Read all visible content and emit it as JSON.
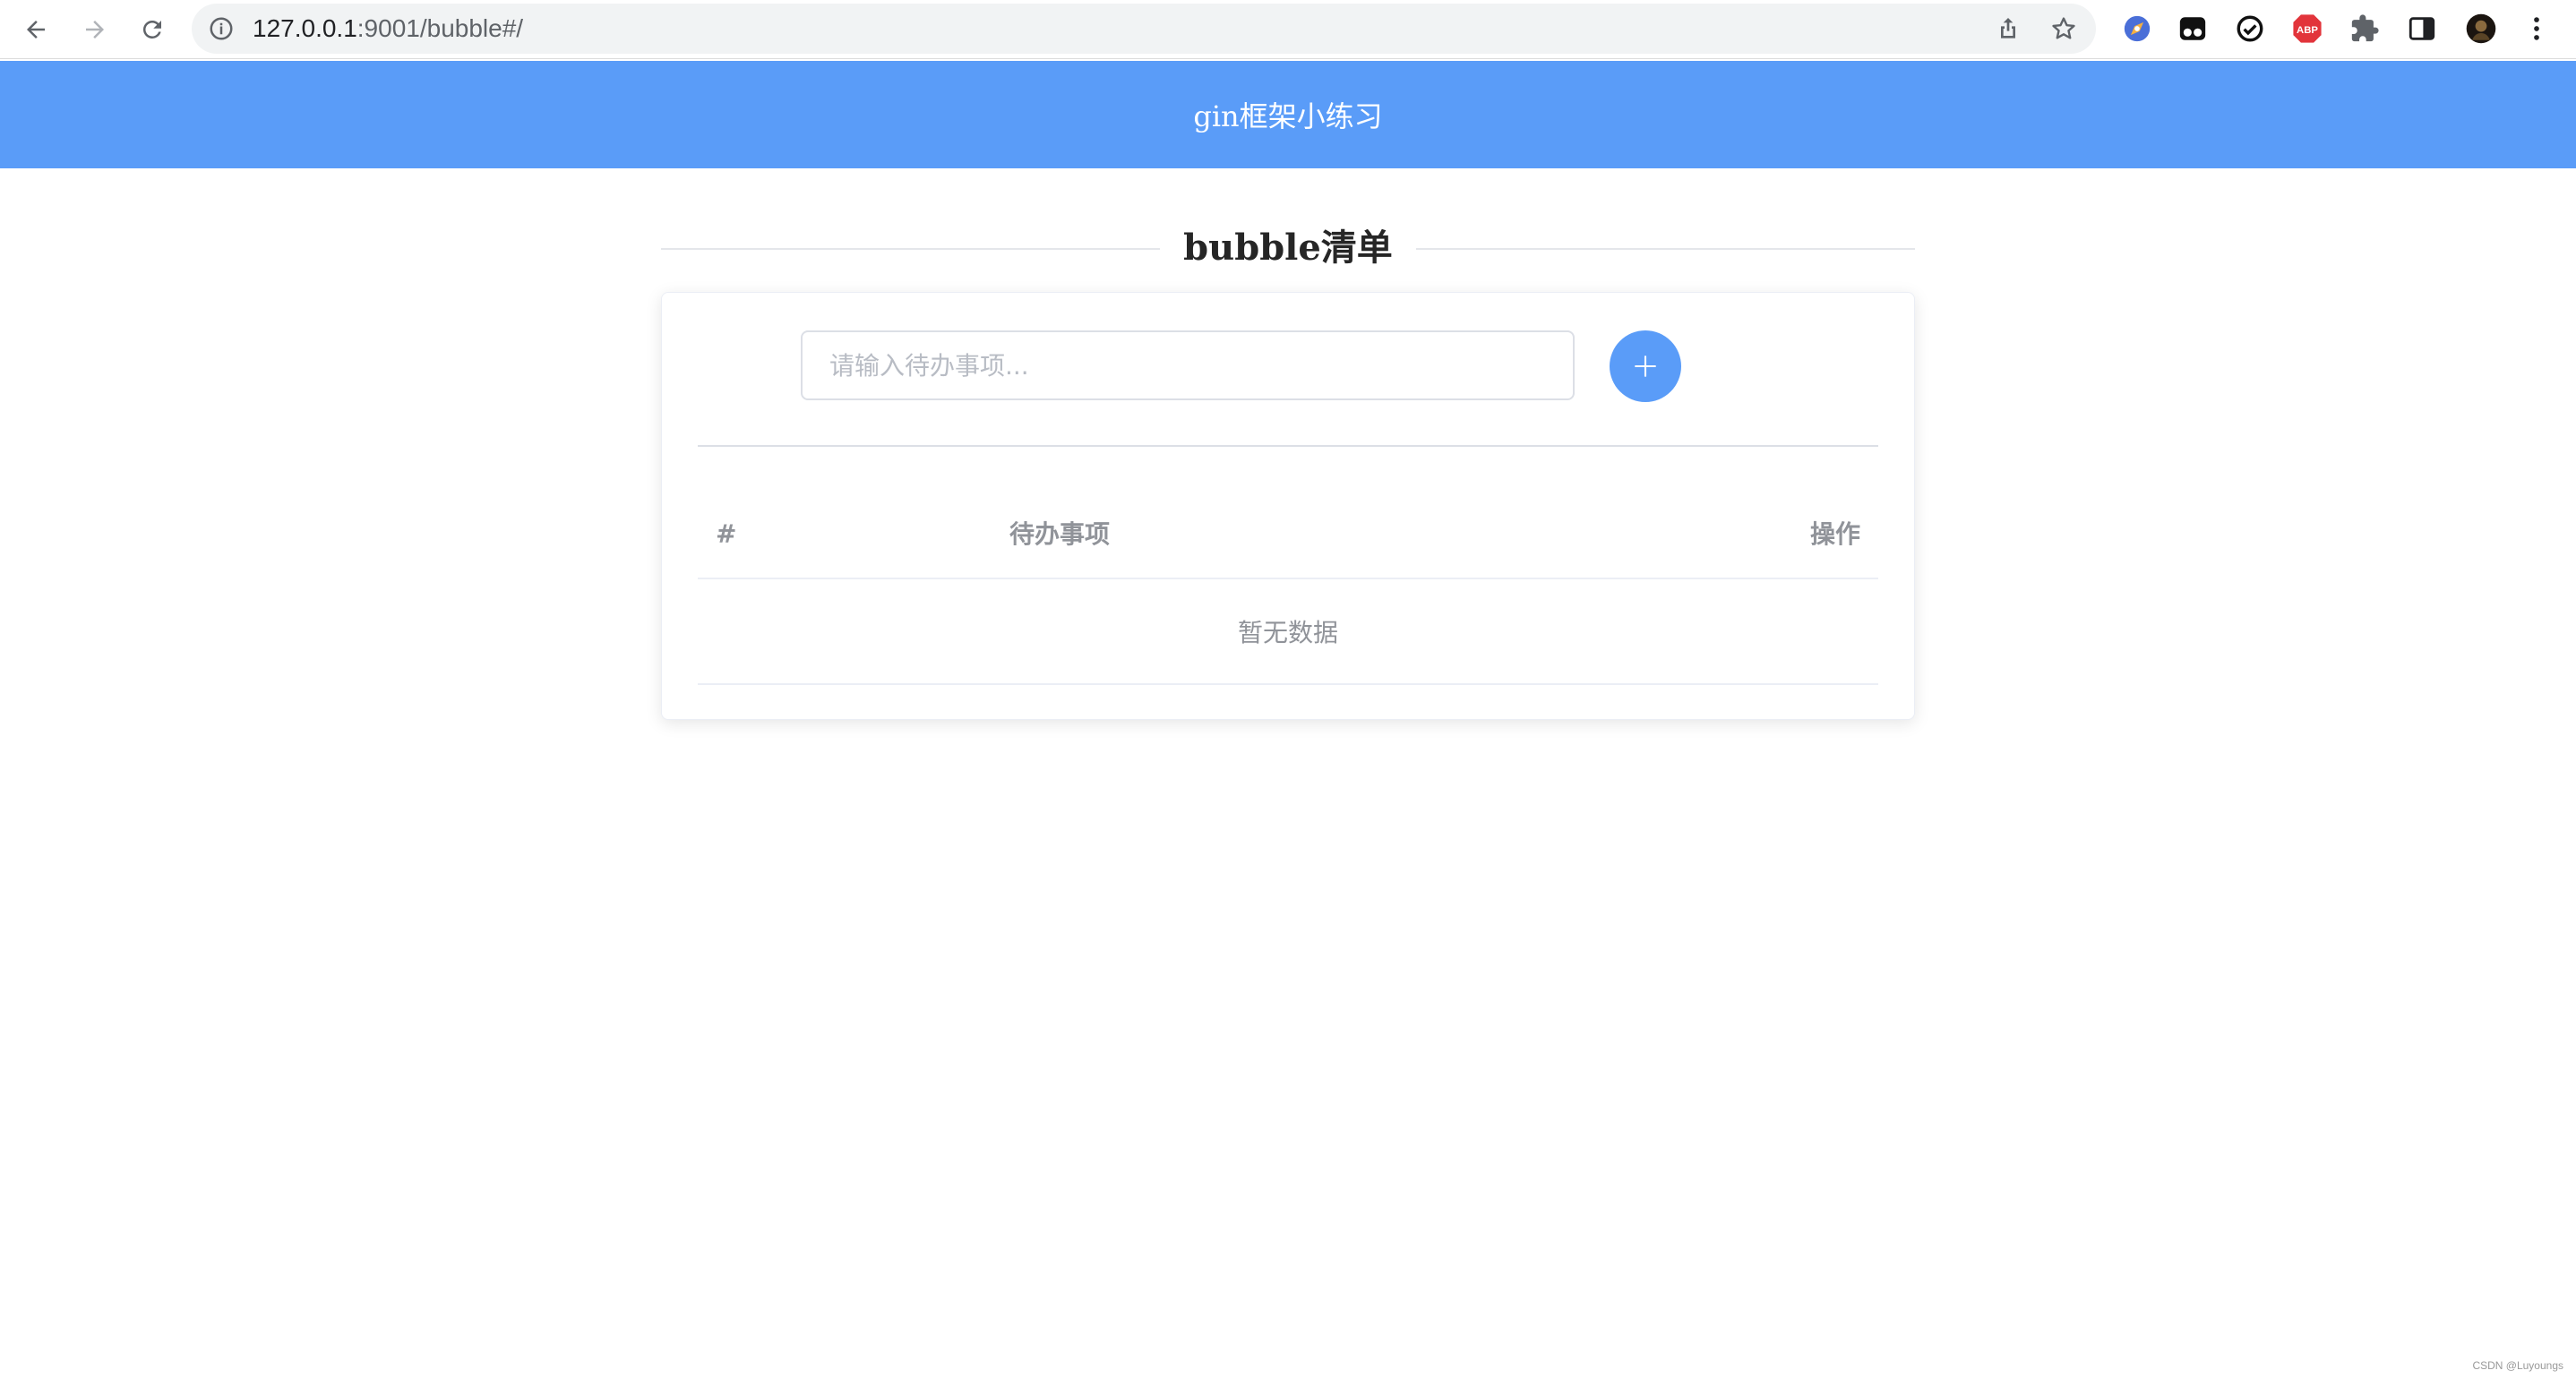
{
  "browser": {
    "url_host": "127.0.0.1",
    "url_rest": ":9001/bubble#/",
    "extensions": [
      "ext-compass-icon",
      "ext-tampermonkey-icon",
      "ext-check-icon",
      "adblock-plus-icon",
      "extensions-puzzle-icon",
      "side-panel-icon",
      "profile-avatar",
      "menu-kebab-icon"
    ],
    "adblock_label": "ABP"
  },
  "header": {
    "title": "gin框架小练习"
  },
  "section": {
    "title": "bubble清单"
  },
  "form": {
    "input_placeholder": "请输入待办事项...",
    "input_value": ""
  },
  "table": {
    "columns": [
      "#",
      "待办事项",
      "操作"
    ],
    "rows": [],
    "empty_text": "暂无数据"
  },
  "watermark": "CSDN @Luyoungs",
  "colors": {
    "primary": "#5a9cf8",
    "text": "#262626",
    "muted": "#909399"
  }
}
